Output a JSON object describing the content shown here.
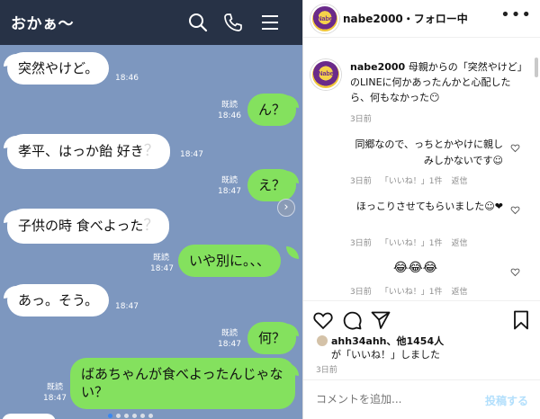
{
  "line": {
    "title": "おかぁ〜",
    "messages": [
      {
        "side": "left",
        "text": "突然やけど。",
        "time": "18:46"
      },
      {
        "side": "right",
        "text": "ん？",
        "read": "既読",
        "time": "18:46"
      },
      {
        "side": "left",
        "text": "孝平、はっか飴 好き",
        "q": "？",
        "time": "18:47"
      },
      {
        "side": "right",
        "text": "え？",
        "read": "既読",
        "time": "18:47"
      },
      {
        "side": "left",
        "text": "子供の時 食べよった",
        "q": "？",
        "time": ""
      },
      {
        "side": "right",
        "text": "いや別に。、、",
        "read": "既読",
        "time": "18:47"
      },
      {
        "side": "left",
        "text": "あっ。そう。",
        "time": "18:47"
      },
      {
        "side": "right",
        "text": "何？",
        "read": "既読",
        "time": "18:47"
      },
      {
        "side": "right",
        "text": "ばあちゃんが食べよったんじゃない？",
        "read": "既読",
        "time": "18:47"
      }
    ],
    "icons": {
      "search": "search-icon",
      "call": "phone-icon",
      "menu": "menu-icon"
    }
  },
  "instagram": {
    "username": "nabe2000",
    "follow_status": "・フォロー中",
    "avatar_text": "Nabe",
    "more": "•••",
    "caption_user": "nabe2000",
    "caption_text": " 母親からの「突然やけど」のLINEに何かあったんかと心配したら、何もなかった😶",
    "caption_time": "3日前",
    "comments": [
      {
        "text": "同郷なので、っちとかやけに親しみしかないです☺",
        "time": "3日前",
        "likes": "「いいね！」1件",
        "reply": "返信"
      },
      {
        "text": "ほっこりさせてもらいました☺❤",
        "time": "3日前",
        "likes": "「いいね！」1件",
        "reply": "返信"
      },
      {
        "text": "😂😂😂",
        "time": "3日前",
        "likes": "「いいね！」1件",
        "reply": "返信"
      }
    ],
    "liked_by_user": "ahh34ahh、",
    "liked_by_rest": "他1454人",
    "liked_by_suffix": "が「いいね！」しました",
    "post_date": "3日前",
    "comment_placeholder": "コメントを追加...",
    "post_label": "投稿する",
    "colors": {
      "line_bg": "#7d97bf",
      "line_header": "#273246",
      "bubble_green": "#84e15e"
    }
  }
}
